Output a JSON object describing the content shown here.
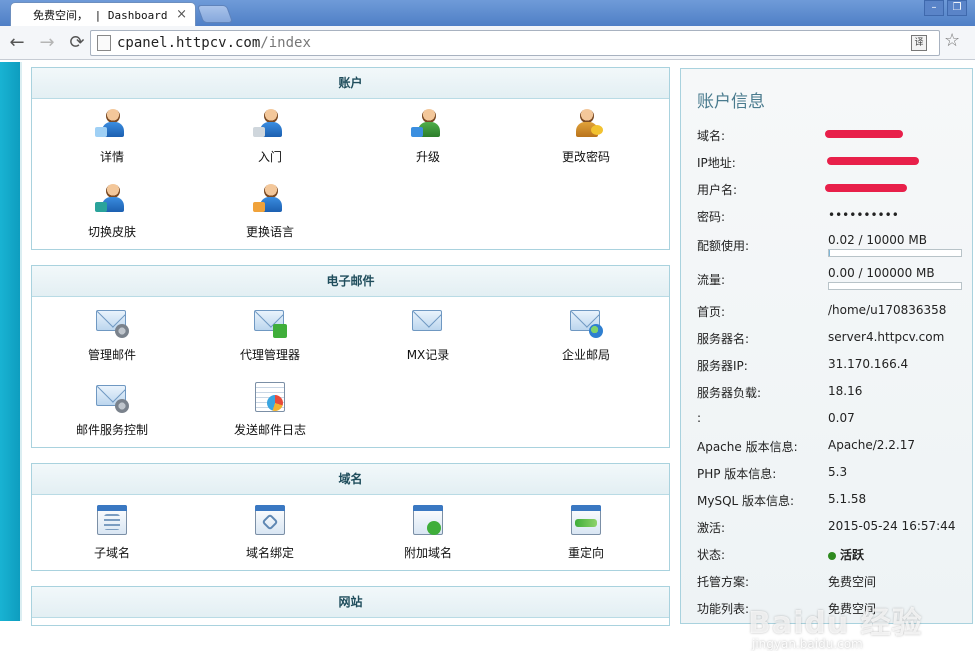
{
  "browser": {
    "tab_title": "免费空间， | Dashboard",
    "url_host": "cpanel.httpcv.com",
    "url_path": "/index",
    "translate_glyph": "译"
  },
  "panels": {
    "account": {
      "title": "账户",
      "items": [
        {
          "label": "详情"
        },
        {
          "label": "入门"
        },
        {
          "label": "升级"
        },
        {
          "label": "更改密码"
        },
        {
          "label": "切换皮肤"
        },
        {
          "label": "更换语言"
        }
      ]
    },
    "email": {
      "title": "电子邮件",
      "items": [
        {
          "label": "管理邮件"
        },
        {
          "label": "代理管理器"
        },
        {
          "label": "MX记录"
        },
        {
          "label": "企业邮局"
        },
        {
          "label": "邮件服务控制"
        },
        {
          "label": "发送邮件日志"
        }
      ]
    },
    "domain": {
      "title": "域名",
      "items": [
        {
          "label": "子域名"
        },
        {
          "label": "域名绑定"
        },
        {
          "label": "附加域名"
        },
        {
          "label": "重定向"
        }
      ]
    },
    "website": {
      "title": "网站"
    }
  },
  "account_info": {
    "title": "账户信息",
    "rows": {
      "domain": {
        "label": "域名:",
        "value": ""
      },
      "ip": {
        "label": "IP地址:",
        "value": ""
      },
      "username": {
        "label": "用户名:",
        "value": ""
      },
      "password": {
        "label": "密码:",
        "value": "••••••••••"
      },
      "quota": {
        "label": "配额使用:",
        "value": "0.02 / 10000 MB",
        "fraction": 2e-06
      },
      "traffic": {
        "label": "流量:",
        "value": "0.00 / 100000 MB",
        "fraction": 0.0
      },
      "home": {
        "label": "首页:",
        "value": "/home/u170836358"
      },
      "server_name": {
        "label": "服务器名:",
        "value": "server4.httpcv.com"
      },
      "server_ip": {
        "label": "服务器IP:",
        "value": "31.170.166.4"
      },
      "server_load": {
        "label": "服务器负载:",
        "value": "18.16"
      },
      "blank": {
        "label": ":",
        "value": "0.07"
      },
      "apache": {
        "label": "Apache 版本信息:",
        "value": "Apache/2.2.17"
      },
      "php": {
        "label": "PHP 版本信息:",
        "value": "5.3"
      },
      "mysql": {
        "label": "MySQL 版本信息:",
        "value": "5.1.58"
      },
      "activated": {
        "label": "激活:",
        "value": "2015-05-24 16:57:44"
      },
      "status": {
        "label": "状态:",
        "value": "活跃"
      },
      "plan": {
        "label": "托管方案:",
        "value": "免费空间"
      },
      "features": {
        "label": "功能列表:",
        "value": "免费空间"
      }
    }
  },
  "watermark": {
    "text": "Baidu 经验",
    "sub": "jingyan.baidu.com"
  },
  "colors": {
    "accent": "#1f4d5c",
    "redaction": "#e8204a",
    "status_ok": "#2e8a1f"
  }
}
